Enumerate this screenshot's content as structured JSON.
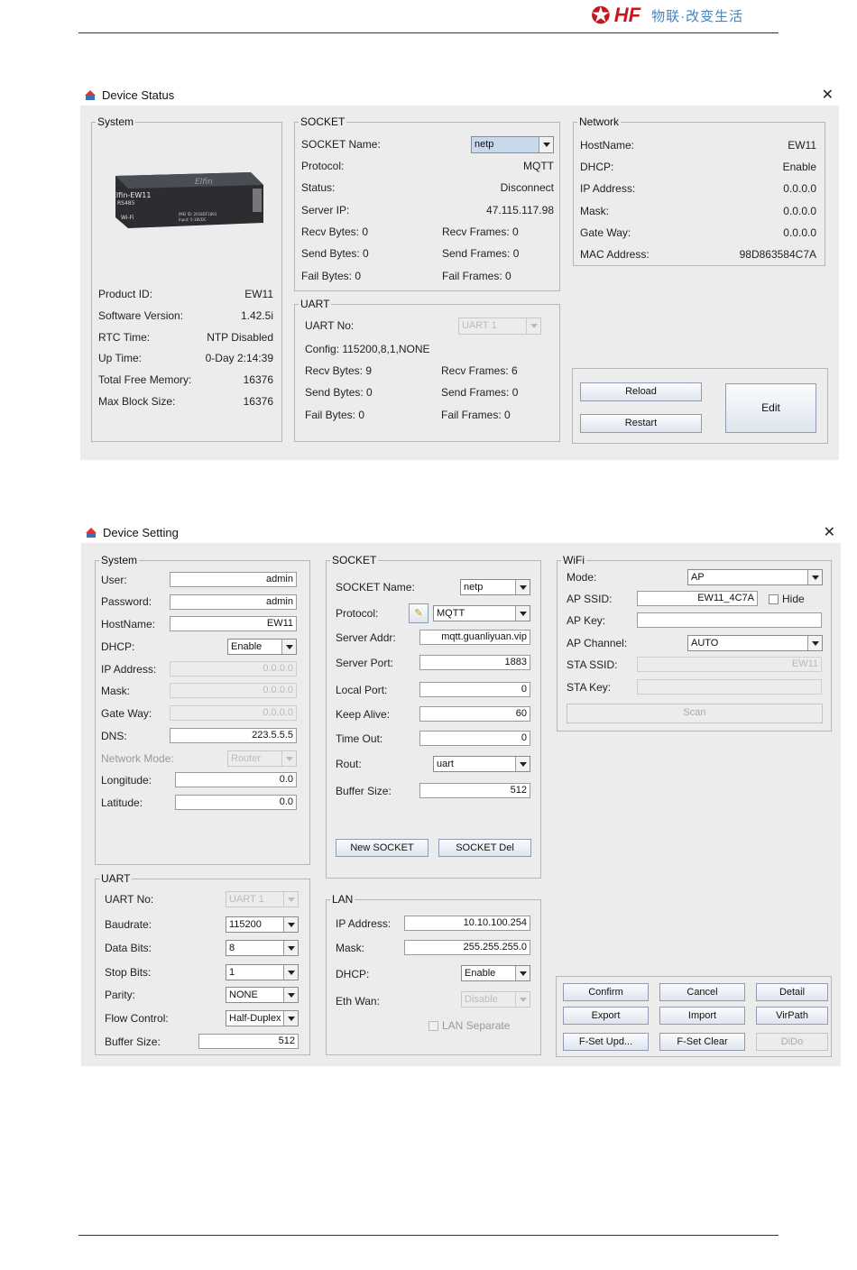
{
  "header": {
    "brand": "HF",
    "slogan": "物联·改变生活"
  },
  "status": {
    "title": "Device Status",
    "system": {
      "legend": "System",
      "device_lines": [
        "Elfin-EW11",
        "RS485",
        "Wi-Fi",
        "IMEI ID: 2018DF1893",
        "Input: 5-18VDC"
      ],
      "device_brand": "Elfin",
      "rows": [
        {
          "label": "Product ID:",
          "value": "EW11"
        },
        {
          "label": "Software Version:",
          "value": "1.42.5i"
        },
        {
          "label": "RTC Time:",
          "value": "NTP Disabled"
        },
        {
          "label": "Up Time:",
          "value": "0-Day 2:14:39"
        },
        {
          "label": "Total Free Memory:",
          "value": "16376"
        },
        {
          "label": "Max Block Size:",
          "value": "16376"
        }
      ]
    },
    "socket": {
      "legend": "SOCKET",
      "name_label": "SOCKET Name:",
      "name_value": "netp",
      "rows": [
        {
          "label": "Protocol:",
          "value": "MQTT"
        },
        {
          "label": "Status:",
          "value": "Disconnect"
        },
        {
          "label": "Server IP:",
          "value": "47.115.117.98"
        }
      ],
      "recv_bytes": "Recv Bytes: 0",
      "recv_frames": "Recv Frames: 0",
      "send_bytes": "Send Bytes: 0",
      "send_frames": "Send Frames: 0",
      "fail_bytes": "Fail Bytes: 0",
      "fail_frames": "Fail Frames: 0"
    },
    "uart": {
      "legend": "UART",
      "no_label": "UART No:",
      "no_value": "UART 1",
      "config": "Config: 115200,8,1,NONE",
      "recv_bytes": "Recv Bytes: 9",
      "recv_frames": "Recv Frames: 6",
      "send_bytes": "Send Bytes: 0",
      "send_frames": "Send Frames: 0",
      "fail_bytes": "Fail Bytes: 0",
      "fail_frames": "Fail Frames: 0"
    },
    "network": {
      "legend": "Network",
      "rows": [
        {
          "label": "HostName:",
          "value": "EW11"
        },
        {
          "label": "DHCP:",
          "value": "Enable"
        },
        {
          "label": "IP Address:",
          "value": "0.0.0.0"
        },
        {
          "label": "Mask:",
          "value": "0.0.0.0"
        },
        {
          "label": "Gate Way:",
          "value": "0.0.0.0"
        },
        {
          "label": "MAC Address:",
          "value": "98D863584C7A"
        }
      ]
    },
    "buttons": {
      "reload": "Reload",
      "restart": "Restart",
      "edit": "Edit"
    }
  },
  "setting": {
    "title": "Device Setting",
    "system": {
      "legend": "System",
      "user_label": "User:",
      "user_value": "admin",
      "password_label": "Password:",
      "password_value": "admin",
      "hostname_label": "HostName:",
      "hostname_value": "EW11",
      "dhcp_label": "DHCP:",
      "dhcp_value": "Enable",
      "ip_label": "IP Address:",
      "ip_value": "0.0.0.0",
      "mask_label": "Mask:",
      "mask_value": "0.0.0.0",
      "gateway_label": "Gate Way:",
      "gateway_value": "0.0.0.0",
      "dns_label": "DNS:",
      "dns_value": "223.5.5.5",
      "netmode_label": "Network Mode:",
      "netmode_value": "Router",
      "longitude_label": "Longitude:",
      "longitude_value": "0.0",
      "latitude_label": "Latitude:",
      "latitude_value": "0.0"
    },
    "uart": {
      "legend": "UART",
      "no_label": "UART No:",
      "no_value": "UART 1",
      "baud_label": "Baudrate:",
      "baud_value": "115200",
      "databits_label": "Data Bits:",
      "databits_value": "8",
      "stopbits_label": "Stop Bits:",
      "stopbits_value": "1",
      "parity_label": "Parity:",
      "parity_value": "NONE",
      "flow_label": "Flow Control:",
      "flow_value": "Half-Duplex",
      "buffer_label": "Buffer Size:",
      "buffer_value": "512"
    },
    "socket": {
      "legend": "SOCKET",
      "name_label": "SOCKET Name:",
      "name_value": "netp",
      "protocol_label": "Protocol:",
      "protocol_value": "MQTT",
      "addr_label": "Server Addr:",
      "addr_value": "mqtt.guanliyuan.vip",
      "port_label": "Server Port:",
      "port_value": "1883",
      "local_label": "Local Port:",
      "local_value": "0",
      "keepalive_label": "Keep Alive:",
      "keepalive_value": "60",
      "timeout_label": "Time Out:",
      "timeout_value": "0",
      "rout_label": "Rout:",
      "rout_value": "uart",
      "buffer_label": "Buffer Size:",
      "buffer_value": "512",
      "new_button": "New SOCKET",
      "del_button": "SOCKET Del"
    },
    "lan": {
      "legend": "LAN",
      "ip_label": "IP Address:",
      "ip_value": "10.10.100.254",
      "mask_label": "Mask:",
      "mask_value": "255.255.255.0",
      "dhcp_label": "DHCP:",
      "dhcp_value": "Enable",
      "ethwan_label": "Eth Wan:",
      "ethwan_value": "Disable",
      "separate_label": "LAN Separate"
    },
    "wifi": {
      "legend": "WiFi",
      "mode_label": "Mode:",
      "mode_value": "AP",
      "ssid_label": "AP SSID:",
      "ssid_value": "EW11_4C7A",
      "hide_label": "Hide",
      "key_label": "AP Key:",
      "key_value": "",
      "channel_label": "AP Channel:",
      "channel_value": "AUTO",
      "sta_ssid_label": "STA SSID:",
      "sta_ssid_value": "EW11",
      "sta_key_label": "STA Key:",
      "sta_key_value": "",
      "scan_button": "Scan"
    },
    "buttons": {
      "confirm": "Confirm",
      "cancel": "Cancel",
      "detail": "Detail",
      "export": "Export",
      "import": "Import",
      "virpath": "VirPath",
      "fset_upd": "F-Set Upd...",
      "fset_clear": "F-Set Clear",
      "dido": "DiDo"
    }
  }
}
